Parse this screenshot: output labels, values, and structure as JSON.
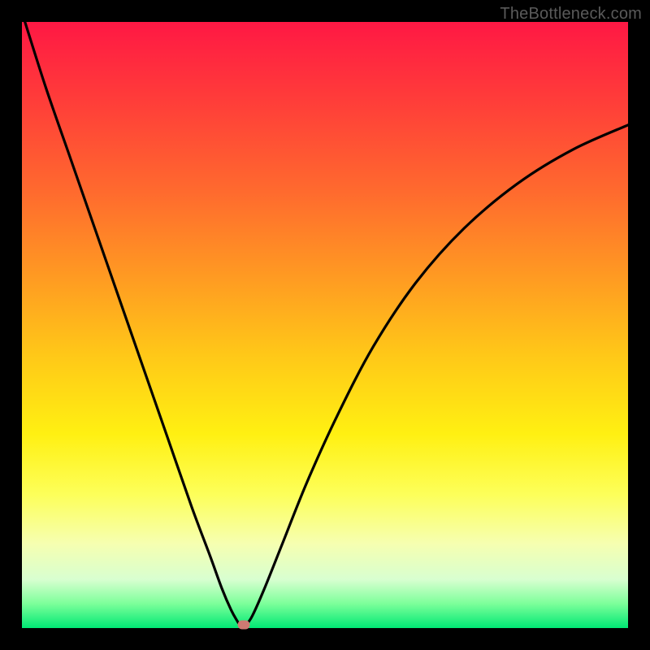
{
  "watermark": "TheBottleneck.com",
  "colors": {
    "frame_bg": "#000000",
    "curve_stroke": "#000000",
    "dot_fill": "#cf7a72",
    "gradient_top": "#ff1844",
    "gradient_bottom": "#00e874"
  },
  "chart_data": {
    "type": "line",
    "title": "",
    "xlabel": "",
    "ylabel": "",
    "xlim": [
      0,
      100
    ],
    "ylim": [
      0,
      100
    ],
    "notes": "V-shaped bottleneck curve on gradient background; minimum near x≈36, y≈0. No axis ticks or labels visible.",
    "series": [
      {
        "name": "curve",
        "x": [
          0.5,
          4,
          8,
          12,
          16,
          20,
          24,
          28,
          31,
          33,
          34.5,
          35.5,
          36.2,
          37,
          38,
          40,
          43,
          47,
          52,
          58,
          65,
          73,
          82,
          91,
          100
        ],
        "y": [
          100,
          89,
          77.5,
          66,
          54.5,
          43,
          31.5,
          20,
          12,
          6.5,
          3,
          1.2,
          0.2,
          0.6,
          2,
          6.5,
          14,
          24,
          35,
          46.5,
          57,
          66,
          73.5,
          79,
          83
        ]
      }
    ],
    "marker": {
      "x": 36.6,
      "y": 0.6
    }
  }
}
